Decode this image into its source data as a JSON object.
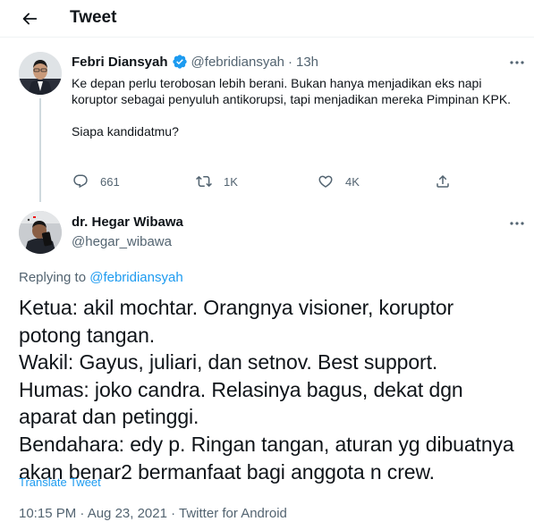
{
  "header": {
    "title": "Tweet"
  },
  "original_tweet": {
    "name": "Febri Diansyah",
    "handle": "@febridiansyah",
    "separator": "·",
    "time": "13h",
    "text_paragraphs": [
      "Ke depan perlu terobosan lebih berani. Bukan hanya menjadikan eks napi koruptor sebagai penyuluh antikorupsi, tapi menjadikan mereka Pimpinan KPK.",
      "Siapa kandidatmu?"
    ],
    "actions": {
      "reply_count": "661",
      "retweet_count": "1K",
      "like_count": "4K"
    }
  },
  "reply_tweet": {
    "name": "dr. Hegar Wibawa",
    "handle": "@hegar_wibawa",
    "replying_prefix": "Replying to",
    "replying_to": "@febridiansyah",
    "text_lines": [
      "Ketua: akil mochtar. Orangnya visioner, koruptor",
      "potong tangan.",
      "Wakil: Gayus, juliari, dan setnov. Best support.",
      "Humas: joko candra. Relasinya bagus, dekat dgn",
      "aparat dan petinggi.",
      "Bendahara: edy p. Ringan tangan, aturan yg dibuatnya",
      "akan benar2 bermanfaat bagi anggota n crew."
    ],
    "translate_label": "Translate Tweet",
    "meta": "10:15 PM · Aug 23, 2021 · Twitter for Android"
  },
  "colors": {
    "accent": "#1d9bf0",
    "secondary_text": "#536471",
    "primary_text": "#0f1419"
  }
}
